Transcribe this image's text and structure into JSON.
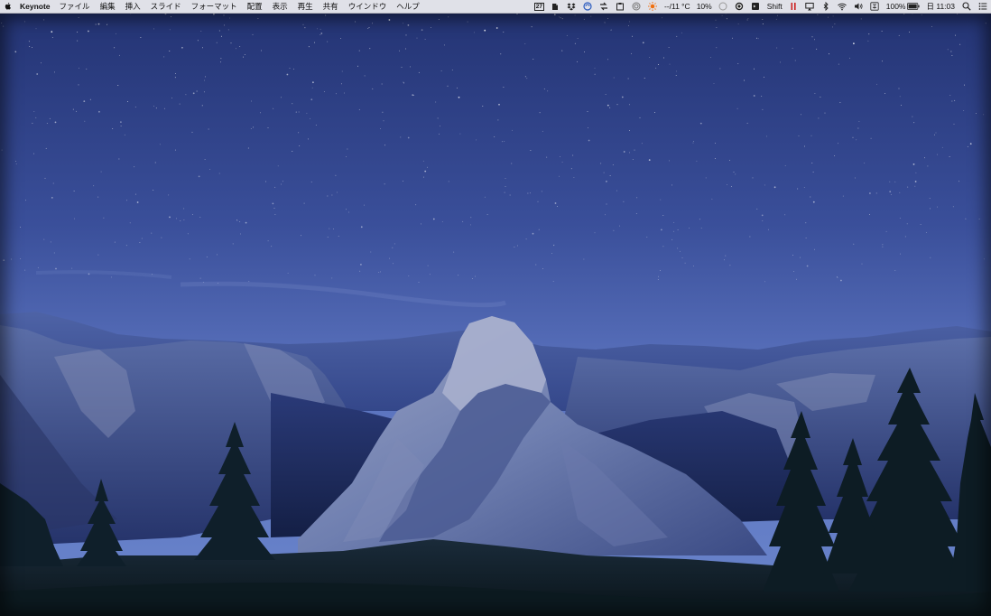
{
  "menubar": {
    "app_name": "Keynote",
    "menus": [
      "ファイル",
      "編集",
      "挿入",
      "スライド",
      "フォーマット",
      "配置",
      "表示",
      "再生",
      "共有",
      "ウインドウ",
      "ヘルプ"
    ],
    "status": {
      "calendar_day": "27",
      "weather": "--/11 °C",
      "cpu": "10%",
      "shift_label": "Shift",
      "battery": "100%",
      "clock": "日 11:03"
    }
  },
  "icons": {
    "apple": "apple-icon",
    "evernote": "evernote-icon",
    "dropbox": "dropbox-icon",
    "spotlight": "search-icon",
    "notification": "list-icon"
  },
  "colors": {
    "sky_top": "#2c3f88",
    "sky_bottom": "#6077c0",
    "accent_red": "#cc2020"
  }
}
